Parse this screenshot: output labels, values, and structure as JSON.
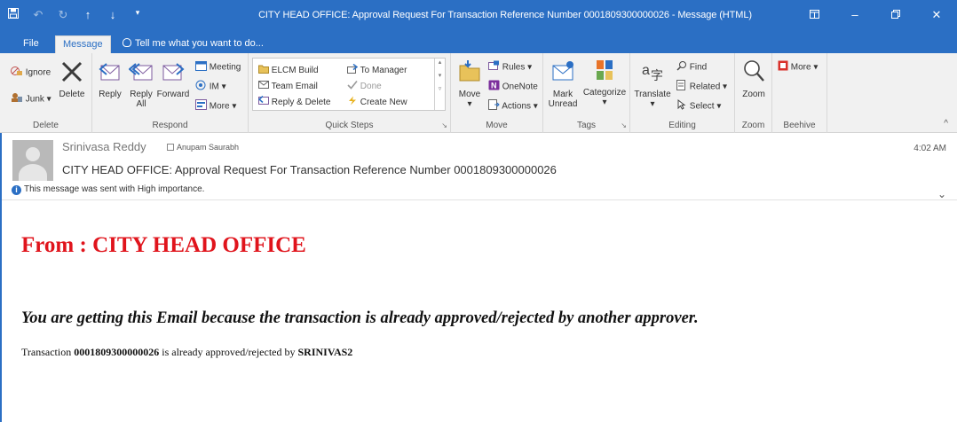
{
  "window": {
    "title": "CITY HEAD OFFICE: Approval Request For Transaction Reference Number 0001809300000026 - Message (HTML)"
  },
  "tabs": {
    "file": "File",
    "message": "Message",
    "tell_me": "Tell me what you want to do..."
  },
  "ribbon": {
    "delete_group": {
      "label": "Delete",
      "ignore": "Ignore",
      "junk": "Junk",
      "delete": "Delete"
    },
    "respond_group": {
      "label": "Respond",
      "reply": "Reply",
      "reply_all_1": "Reply",
      "reply_all_2": "All",
      "forward": "Forward",
      "meeting": "Meeting",
      "im": "IM",
      "more": "More"
    },
    "quick_steps_group": {
      "label": "Quick Steps",
      "elcm_build": "ELCM Build",
      "team_email": "Team Email",
      "reply_delete": "Reply & Delete",
      "to_manager": "To Manager",
      "done": "Done",
      "create_new": "Create New"
    },
    "move_group": {
      "label": "Move",
      "move": "Move",
      "rules": "Rules",
      "onenote": "OneNote",
      "actions": "Actions"
    },
    "tags_group": {
      "label": "Tags",
      "mark_unread_1": "Mark",
      "mark_unread_2": "Unread",
      "categorize": "Categorize"
    },
    "editing_group": {
      "label": "Editing",
      "translate": "Translate",
      "find": "Find",
      "related": "Related",
      "select": "Select"
    },
    "zoom_group": {
      "label": "Zoom",
      "zoom": "Zoom"
    },
    "beehive_group": {
      "label": "Beehive",
      "more": "More"
    }
  },
  "header": {
    "sender": "Srinivasa Reddy",
    "recipient": "Anupam Saurabh",
    "subject": "CITY HEAD OFFICE: Approval Request For Transaction Reference Number 0001809300000026",
    "time": "4:02 AM",
    "importance": "This message was sent with High importance."
  },
  "body": {
    "from_line": "From : CITY HEAD OFFICE",
    "info_line": "You are getting this Email because the transaction is already approved/rejected by another approver.",
    "txn_prefix": "Transaction ",
    "txn_number": "0001809300000026",
    "txn_middle": " is already approved/rejected by ",
    "txn_user": "SRINIVAS2"
  },
  "colors": {
    "accent": "#2b6fc4",
    "from_red": "#e0141c"
  }
}
